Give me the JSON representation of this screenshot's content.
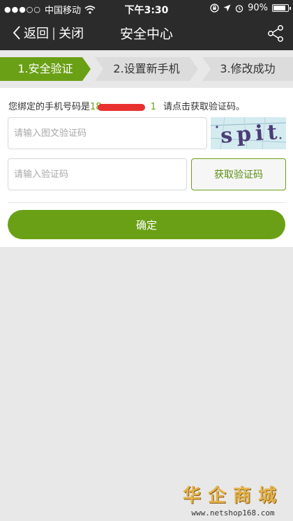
{
  "status_bar": {
    "carrier": "中国移动",
    "time": "下午3:30",
    "battery": "90%",
    "battery_level": 0.9
  },
  "nav": {
    "back_label": "返回",
    "close_label": "关闭",
    "title": "安全中心"
  },
  "steps": [
    {
      "label": "1.安全验证",
      "active": true
    },
    {
      "label": "2.设置新手机",
      "active": false
    },
    {
      "label": "3.修改成功",
      "active": false
    }
  ],
  "form": {
    "bind_prefix": "您绑定的手机号码是",
    "phone_visible": "18",
    "phone_tail": "1",
    "bind_suffix": "请点击获取验证码。",
    "image_code_placeholder": "请输入图文验证码",
    "captcha_text": "spit",
    "sms_code_placeholder": "请输入验证码",
    "get_code_label": "获取验证码",
    "confirm_label": "确定"
  },
  "watermark": {
    "brand": "华企商城",
    "url": "www.netshop168.com"
  },
  "colors": {
    "accent": "#6aa016",
    "nav_bg": "#2b2b2b",
    "redaction": "#e8312f"
  }
}
